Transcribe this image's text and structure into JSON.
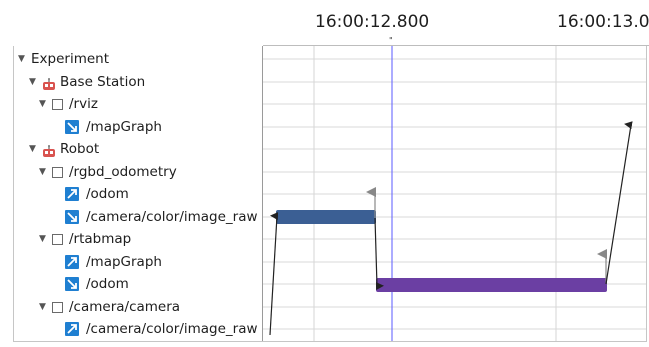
{
  "header": {
    "tick_labels": [
      "16:00:12.800",
      "16:00:13.0"
    ],
    "cursor_marker": "\""
  },
  "tree": [
    {
      "label": "Experiment",
      "icon": "none",
      "expanded": true
    },
    {
      "label": "Base Station",
      "icon": "robot-icon",
      "expanded": true
    },
    {
      "label": "/rviz",
      "icon": "node-checkbox",
      "expanded": true
    },
    {
      "label": "/mapGraph",
      "icon": "subscribe-topic-icon"
    },
    {
      "label": "Robot",
      "icon": "robot-icon",
      "expanded": true
    },
    {
      "label": "/rgbd_odometry",
      "icon": "node-checkbox",
      "expanded": true
    },
    {
      "label": "/odom",
      "icon": "publish-topic-icon"
    },
    {
      "label": "/camera/color/image_raw",
      "icon": "subscribe-topic-icon"
    },
    {
      "label": "/rtabmap",
      "icon": "node-checkbox",
      "expanded": true
    },
    {
      "label": "/mapGraph",
      "icon": "publish-topic-icon"
    },
    {
      "label": "/odom",
      "icon": "subscribe-topic-icon"
    },
    {
      "label": "/camera/camera",
      "icon": "node-checkbox",
      "expanded": true
    },
    {
      "label": "/camera/color/image_raw",
      "icon": "publish-topic-icon"
    }
  ],
  "colors": {
    "rgbd_odometry_callback": "#3b5f94",
    "rtabmap_callback": "#6b3fa3",
    "cursor_line": "#5a5aff",
    "grid": "#d6d6d6",
    "arrow": "#222222"
  }
}
